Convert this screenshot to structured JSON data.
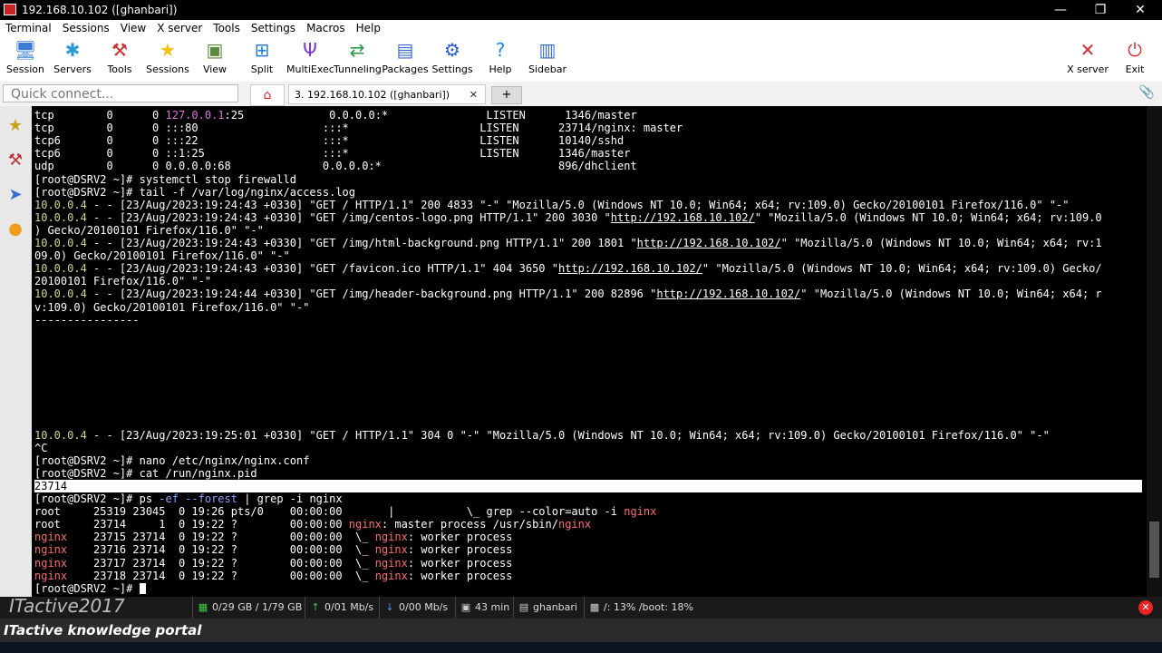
{
  "window": {
    "title": "192.168.10.102 ([ghanbari])",
    "min": "—",
    "restore": "❐",
    "close": "✕"
  },
  "menu": [
    "Terminal",
    "Sessions",
    "View",
    "X server",
    "Tools",
    "Settings",
    "Macros",
    "Help"
  ],
  "toolbar": {
    "left": [
      {
        "label": "Session",
        "icon": "session-icon",
        "glyph": "🖥",
        "color": "#3a7bd5"
      },
      {
        "label": "Servers",
        "icon": "servers-icon",
        "glyph": "✱",
        "color": "#2a9bd8"
      },
      {
        "label": "Tools",
        "icon": "tools-icon",
        "glyph": "⚒",
        "color": "#d03030"
      },
      {
        "label": "Sessions",
        "icon": "star-icon",
        "glyph": "★",
        "color": "#f4c20d"
      },
      {
        "label": "View",
        "icon": "view-icon",
        "glyph": "▣",
        "color": "#5a8a3a"
      },
      {
        "label": "Split",
        "icon": "split-icon",
        "glyph": "⊞",
        "color": "#2a7bd5"
      },
      {
        "label": "MultiExec",
        "icon": "multiexec-icon",
        "glyph": "Ψ",
        "color": "#7a3ad5"
      },
      {
        "label": "Tunneling",
        "icon": "tunneling-icon",
        "glyph": "⇄",
        "color": "#2a9a4a"
      },
      {
        "label": "Packages",
        "icon": "packages-icon",
        "glyph": "▤",
        "color": "#3a6ad5"
      },
      {
        "label": "Settings",
        "icon": "gear-icon",
        "glyph": "⚙",
        "color": "#2a5ad5"
      },
      {
        "label": "Help",
        "icon": "help-icon",
        "glyph": "?",
        "color": "#1a8ae5"
      },
      {
        "label": "Sidebar",
        "icon": "sidebar-icon",
        "glyph": "▥",
        "color": "#3a6ad5"
      }
    ],
    "right": [
      {
        "label": "X server",
        "icon": "xserver-icon",
        "glyph": "✕",
        "color": "#d03030"
      },
      {
        "label": "Exit",
        "icon": "power-icon",
        "glyph": "⏻",
        "color": "#e03030"
      }
    ]
  },
  "tabs": {
    "quick_connect_placeholder": "Quick connect...",
    "home_glyph": "⌂",
    "active_tab": "3. 192.168.10.102 ([ghanbari])",
    "tab_close": "✕",
    "new_tab": "+",
    "clip_glyph": "📎"
  },
  "terminal_lines": [
    [
      {
        "t": "tcp        0      0 "
      },
      {
        "t": "127.0.0.1",
        "c": "mag"
      },
      {
        "t": ":25             0.0.0.0:*               LISTEN      1346/master"
      }
    ],
    [
      {
        "t": "tcp        0      0 :::80                   :::*                    LISTEN      23714/nginx: master"
      }
    ],
    [
      {
        "t": "tcp6       0      0 :::22                   :::*                    LISTEN      10140/sshd"
      }
    ],
    [
      {
        "t": "tcp6       0      0 ::1:25                  :::*                    LISTEN      1346/master"
      }
    ],
    [
      {
        "t": "udp        0      0 0.0.0.0:68              0.0.0.0:*                           896/dhclient"
      }
    ],
    [
      {
        "t": "[root@DSRV2 ~]# systemctl stop firewalld"
      }
    ],
    [
      {
        "t": "[root@DSRV2 ~]# tail -f /var/log/nginx/access.log"
      }
    ],
    [
      {
        "t": "10.0.0.4",
        "c": "ip"
      },
      {
        "t": " - - [23/Aug/2023:19:24:43 +0330] \"GET / HTTP/1.1\" 200 4833 \"-\" \"Mozilla/5.0 (Windows NT 10.0; Win64; x64; rv:109.0) Gecko/20100101 Firefox/116.0\" \"-\""
      }
    ],
    [
      {
        "t": "10.0.0.4",
        "c": "ip"
      },
      {
        "t": " - - [23/Aug/2023:19:24:43 +0330] \"GET /img/centos-logo.png HTTP/1.1\" 200 3030 \""
      },
      {
        "t": "http://192.168.10.102/",
        "c": "lnk"
      },
      {
        "t": "\" \"Mozilla/5.0 (Windows NT 10.0; Win64; x64; rv:109.0"
      }
    ],
    [
      {
        "t": ") Gecko/20100101 Firefox/116.0\" \"-\""
      }
    ],
    [
      {
        "t": "10.0.0.4",
        "c": "ip"
      },
      {
        "t": " - - [23/Aug/2023:19:24:43 +0330] \"GET /img/html-background.png HTTP/1.1\" 200 1801 \""
      },
      {
        "t": "http://192.168.10.102/",
        "c": "lnk"
      },
      {
        "t": "\" \"Mozilla/5.0 (Windows NT 10.0; Win64; x64; rv:1"
      }
    ],
    [
      {
        "t": "09.0) Gecko/20100101 Firefox/116.0\" \"-\""
      }
    ],
    [
      {
        "t": "10.0.0.4",
        "c": "ip"
      },
      {
        "t": " - - [23/Aug/2023:19:24:43 +0330] \"GET /favicon.ico HTTP/1.1\" 404 3650 \""
      },
      {
        "t": "http://192.168.10.102/",
        "c": "lnk"
      },
      {
        "t": "\" \"Mozilla/5.0 (Windows NT 10.0; Win64; x64; rv:109.0) Gecko/"
      }
    ],
    [
      {
        "t": "20100101 Firefox/116.0\" \"-\""
      }
    ],
    [
      {
        "t": "10.0.0.4",
        "c": "ip"
      },
      {
        "t": " - - [23/Aug/2023:19:24:44 +0330] \"GET /img/header-background.png HTTP/1.1\" 200 82896 \""
      },
      {
        "t": "http://192.168.10.102/",
        "c": "lnk"
      },
      {
        "t": "\" \"Mozilla/5.0 (Windows NT 10.0; Win64; x64; r"
      }
    ],
    [
      {
        "t": "v:109.0) Gecko/20100101 Firefox/116.0\" \"-\""
      }
    ],
    [
      {
        "t": "----------------"
      }
    ],
    [
      {
        "t": ""
      }
    ],
    [
      {
        "t": ""
      }
    ],
    [
      {
        "t": ""
      }
    ],
    [
      {
        "t": ""
      }
    ],
    [
      {
        "t": ""
      }
    ],
    [
      {
        "t": ""
      }
    ],
    [
      {
        "t": ""
      }
    ],
    [
      {
        "t": ""
      }
    ],
    [
      {
        "t": "10.0.0.4",
        "c": "ip"
      },
      {
        "t": " - - [23/Aug/2023:19:25:01 +0330] \"GET / HTTP/1.1\" 304 0 \"-\" \"Mozilla/5.0 (Windows NT 10.0; Win64; x64; rv:109.0) Gecko/20100101 Firefox/116.0\" \"-\""
      }
    ],
    [
      {
        "t": "^C"
      }
    ],
    [
      {
        "t": "[root@DSRV2 ~]# nano /etc/nginx/nginx.conf"
      }
    ],
    [
      {
        "t": "[root@DSRV2 ~]# cat /run/nginx.pid"
      }
    ],
    [
      {
        "t": "23714",
        "c": "hl"
      }
    ],
    [
      {
        "t": "[root@DSRV2 ~]# ps "
      },
      {
        "t": "-ef --forest",
        "c": "blu"
      },
      {
        "t": " | grep -i nginx"
      }
    ],
    [
      {
        "t": "root     25319 23045  0 19:26 pts/0    00:00:00       |           \\_ grep --color=auto -i "
      },
      {
        "t": "nginx",
        "c": "red"
      }
    ],
    [
      {
        "t": "root     23714     1  0 19:22 ?        00:00:00 "
      },
      {
        "t": "nginx",
        "c": "red"
      },
      {
        "t": ": master process /usr/sbin/"
      },
      {
        "t": "nginx",
        "c": "red"
      }
    ],
    [
      {
        "t": "nginx",
        "c": "red"
      },
      {
        "t": "    23715 23714  0 19:22 ?        00:00:00  \\_ "
      },
      {
        "t": "nginx",
        "c": "red"
      },
      {
        "t": ": worker process"
      }
    ],
    [
      {
        "t": "nginx",
        "c": "red"
      },
      {
        "t": "    23716 23714  0 19:22 ?        00:00:00  \\_ "
      },
      {
        "t": "nginx",
        "c": "red"
      },
      {
        "t": ": worker process"
      }
    ],
    [
      {
        "t": "nginx",
        "c": "red"
      },
      {
        "t": "    23717 23714  0 19:22 ?        00:00:00  \\_ "
      },
      {
        "t": "nginx",
        "c": "red"
      },
      {
        "t": ": worker process"
      }
    ],
    [
      {
        "t": "nginx",
        "c": "red"
      },
      {
        "t": "    23718 23714  0 19:22 ?        00:00:00  \\_ "
      },
      {
        "t": "nginx",
        "c": "red"
      },
      {
        "t": ": worker process"
      }
    ],
    [
      {
        "t": "[root@DSRV2 ~]# "
      },
      {
        "cursor": true
      }
    ]
  ],
  "statusbar": [
    {
      "icon": "disk-icon",
      "glyph": "▦",
      "color": "#4c4",
      "text": "0/29 GB / 1/79 GB"
    },
    {
      "icon": "upload-icon",
      "glyph": "↑",
      "color": "#4c4",
      "text": "0/01 Mb/s"
    },
    {
      "icon": "download-icon",
      "glyph": "↓",
      "color": "#48f",
      "text": "0/00 Mb/s"
    },
    {
      "icon": "clock-icon",
      "glyph": "▣",
      "color": "#ccc",
      "text": "43 min"
    },
    {
      "icon": "user-icon",
      "glyph": "▤",
      "color": "#ccc",
      "text": "ghanbari"
    },
    {
      "icon": "drive-icon",
      "glyph": "▩",
      "color": "#ccc",
      "text": "/: 13%   /boot: 18%"
    }
  ],
  "watermark": "ITactive2017",
  "portal": "ITactive knowledge portal"
}
